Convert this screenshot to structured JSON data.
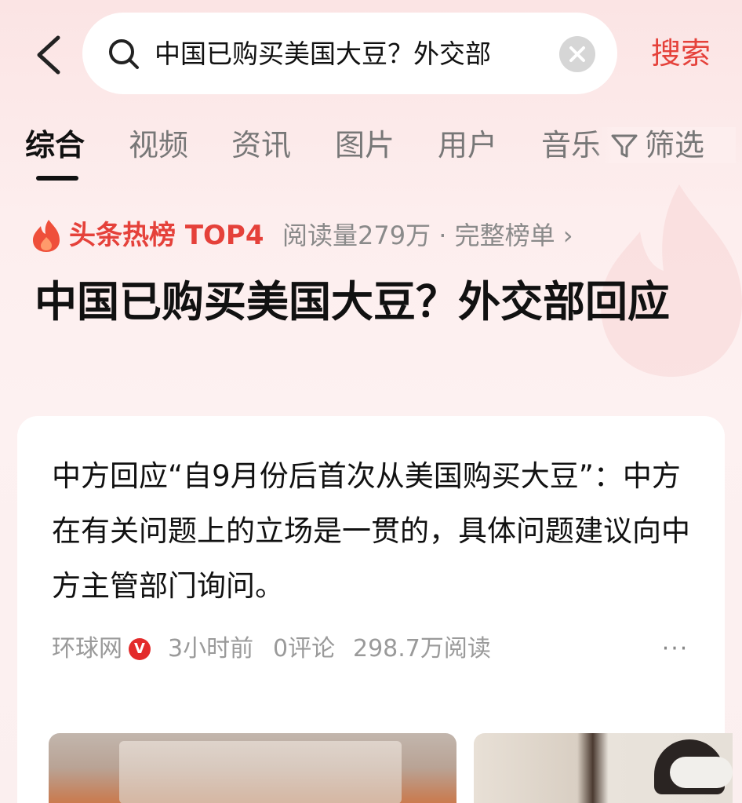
{
  "header": {
    "search_query": "中国已购买美国大豆？外交部",
    "search_button": "搜索"
  },
  "tabs": [
    {
      "label": "综合",
      "active": true
    },
    {
      "label": "视频"
    },
    {
      "label": "资讯"
    },
    {
      "label": "图片"
    },
    {
      "label": "用户"
    },
    {
      "label": "音乐"
    }
  ],
  "filter_label": "筛选",
  "hot": {
    "title": "头条热榜 TOP4",
    "meta": "阅读量279万 · 完整榜单 ›"
  },
  "headline": "中国已购买美国大豆？外交部回应",
  "article": {
    "text": "中方回应“自9月份后首次从美国购买大豆”：中方在有关问题上的立场是一贯的，具体问题建议向中方主管部门询问。",
    "source": "环球网",
    "verified_badge": "V",
    "time": "3小时前",
    "comments": "0评论",
    "reads": "298.7万阅读",
    "more": "···"
  },
  "colors": {
    "accent": "#e5413a",
    "background_top": "#fbe4e4",
    "badge": "#e32b2b"
  }
}
